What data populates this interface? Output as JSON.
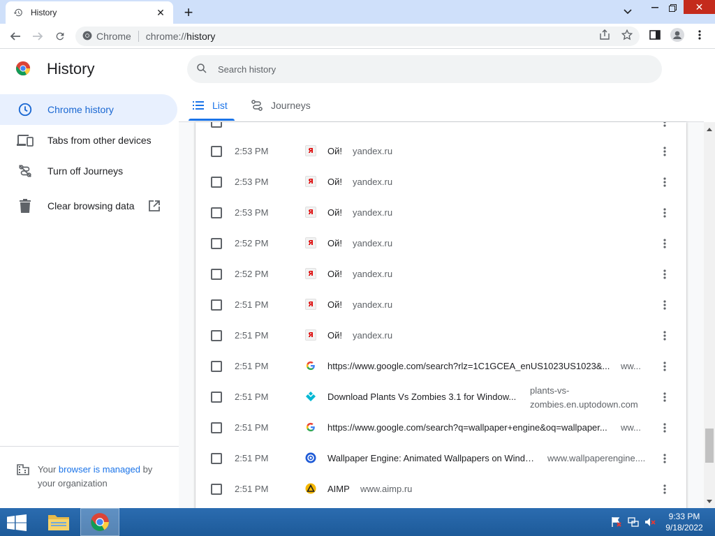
{
  "browser": {
    "tab_title": "History",
    "omnibox_site": "Chrome",
    "omnibox_url_prefix": "chrome://",
    "omnibox_url_path": "history"
  },
  "page": {
    "title": "History",
    "search_placeholder": "Search history"
  },
  "sidebar": {
    "items": [
      {
        "label": "Chrome history",
        "icon": "clock-icon",
        "active": true
      },
      {
        "label": "Tabs from other devices",
        "icon": "devices-icon"
      },
      {
        "label": "Turn off Journeys",
        "icon": "journeys-off-icon"
      },
      {
        "label": "Clear browsing data",
        "icon": "trash-icon"
      }
    ],
    "managed": {
      "prefix": "Your ",
      "link": "browser is managed",
      "suffix": " by your organization"
    }
  },
  "tabs": [
    {
      "label": "List",
      "active": true
    },
    {
      "label": "Journeys"
    }
  ],
  "history": [
    {
      "time": "2:53 PM",
      "title": "Ой!",
      "domain": "yandex.ru",
      "icon": "yandex"
    },
    {
      "time": "2:53 PM",
      "title": "Ой!",
      "domain": "yandex.ru",
      "icon": "yandex"
    },
    {
      "time": "2:53 PM",
      "title": "Ой!",
      "domain": "yandex.ru",
      "icon": "yandex"
    },
    {
      "time": "2:52 PM",
      "title": "Ой!",
      "domain": "yandex.ru",
      "icon": "yandex"
    },
    {
      "time": "2:52 PM",
      "title": "Ой!",
      "domain": "yandex.ru",
      "icon": "yandex"
    },
    {
      "time": "2:51 PM",
      "title": "Ой!",
      "domain": "yandex.ru",
      "icon": "yandex"
    },
    {
      "time": "2:51 PM",
      "title": "Ой!",
      "domain": "yandex.ru",
      "icon": "yandex"
    },
    {
      "time": "2:51 PM",
      "title": "https://www.google.com/search?rlz=1C1GCEA_enUS1023US1023&...",
      "domain": "ww...",
      "icon": "google"
    },
    {
      "time": "2:51 PM",
      "title": "Download Plants Vs Zombies 3.1 for Window...",
      "domain": "plants-vs-zombies.en.uptodown.com",
      "icon": "uptodown"
    },
    {
      "time": "2:51 PM",
      "title": "https://www.google.com/search?q=wallpaper+engine&oq=wallpaper...",
      "domain": "ww...",
      "icon": "google"
    },
    {
      "time": "2:51 PM",
      "title": "Wallpaper Engine: Animated Wallpapers on Windo...",
      "domain": "www.wallpaperengine....",
      "icon": "wallpaperengine"
    },
    {
      "time": "2:51 PM",
      "title": "AIMP",
      "domain": "www.aimp.ru",
      "icon": "aimp"
    }
  ],
  "taskbar": {
    "time": "9:33 PM",
    "date": "9/18/2022"
  },
  "colors": {
    "accent": "#1a73e8",
    "active_sidebar_bg": "#e8f0fe",
    "tabstrip": "#cfe0fa",
    "taskbar": "#1d5a99"
  }
}
